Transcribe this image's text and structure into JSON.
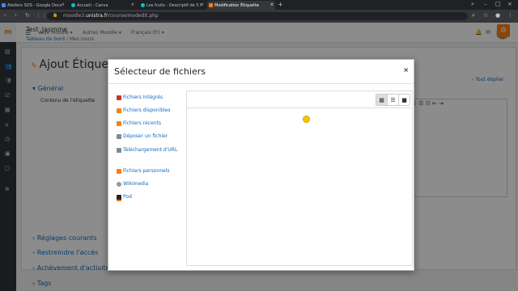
{
  "browser": {
    "tabs": [
      {
        "title": "Ateliers SOS - Google Docs",
        "color": "#4285f4"
      },
      {
        "title": "Accueil - Canva",
        "color": "#00c4cc"
      },
      {
        "title": "Les fruits - Descriptif de 5 f",
        "color": "#00c4cc"
      },
      {
        "title": "Modification Étiquette",
        "color": "#f98012"
      }
    ],
    "url_prefix": "moodle3.",
    "url_host": "unistra.fr",
    "url_path": "/course/modedit.php"
  },
  "moodle": {
    "menu": [
      "Aide Moodle",
      "Autres Moodle",
      "Français (fr)"
    ],
    "course_name": "Test_Jasmine",
    "breadcrumb_home": "Tableau de bord",
    "breadcrumb_sep": "/",
    "breadcrumb_courses": "Mes cours",
    "page_heading": "Ajout Étiquett",
    "expand_all": "Tout déplier",
    "section_general": "Général",
    "field_label": "Contenu de l'étiquette",
    "sections": [
      "Réglages courants",
      "Restreindre l'accès",
      "Achèvement d'activité",
      "Tags"
    ]
  },
  "file_picker": {
    "title": "Sélecteur de fichiers",
    "close": "×",
    "repositories": [
      {
        "label": "Fichiers intégrés",
        "icon": "file-icon",
        "color": "#c0392b"
      },
      {
        "label": "Fichiers disponibles",
        "icon": "moodle-icon",
        "color": "#f98012"
      },
      {
        "label": "Fichiers récents",
        "icon": "moodle-icon",
        "color": "#f98012"
      },
      {
        "label": "Déposer un fichier",
        "icon": "upload-icon",
        "color": "#7f8c8d"
      },
      {
        "label": "Téléchargement d'URL",
        "icon": "url-icon",
        "color": "#7f8c8d"
      },
      {
        "label": "Fichiers personnels",
        "icon": "moodle-icon",
        "color": "#f98012"
      },
      {
        "label": "Wikimedia",
        "icon": "wikimedia-icon",
        "color": "#999999"
      },
      {
        "label": "Pod",
        "icon": "pod-icon",
        "color": "#e67e22"
      }
    ]
  }
}
